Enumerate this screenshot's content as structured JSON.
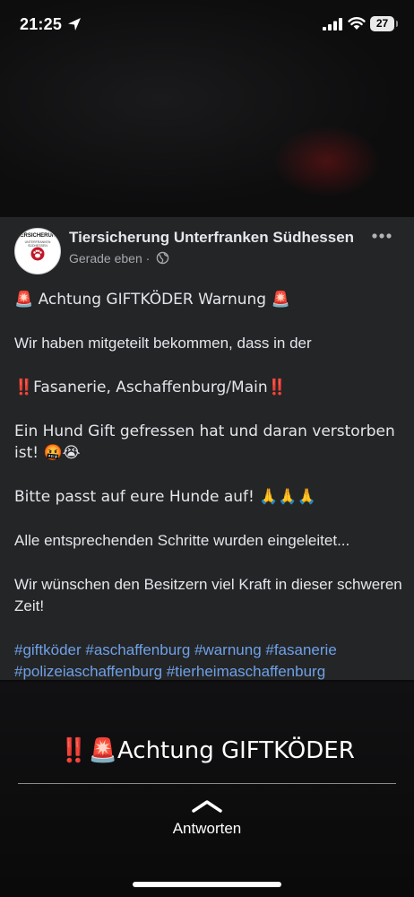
{
  "status_bar": {
    "time": "21:25",
    "battery": "27"
  },
  "post": {
    "author": "Tiersicherung Unterfranken Südhessen",
    "timestamp": "Gerade eben ·",
    "avatar_title": "TIERSICHERUNG",
    "avatar_subtitle": "UNTERFRANKEN SÜDHESSEN",
    "lines": {
      "l1": "🚨 Achtung GIFTKÖDER Warnung 🚨",
      "l2": "Wir haben mitgeteilt bekommen, dass in der",
      "l3": "‼️Fasanerie, Aschaffenburg/Main‼️",
      "l4": "Ein Hund Gift gefressen hat und daran verstorben ist! 🤬😭",
      "l5": "Bitte passt auf eure Hunde auf! 🙏🙏🙏",
      "l6": "Alle entsprechenden Schritte wurden eingeleitet...",
      "l7": "Wir wünschen den Besitzern viel Kraft in dieser schweren Zeit!",
      "hashtags": "#giftköder #aschaffenburg #warnung #fasanerie #polizeiaschaffenburg #tierheimaschaffenburg"
    }
  },
  "story": {
    "headline": "‼️🚨Achtung GIFTKÖDER",
    "reply_label": "Antworten"
  },
  "colors": {
    "card_bg": "#242526",
    "hashtag": "#6ea0e8"
  }
}
